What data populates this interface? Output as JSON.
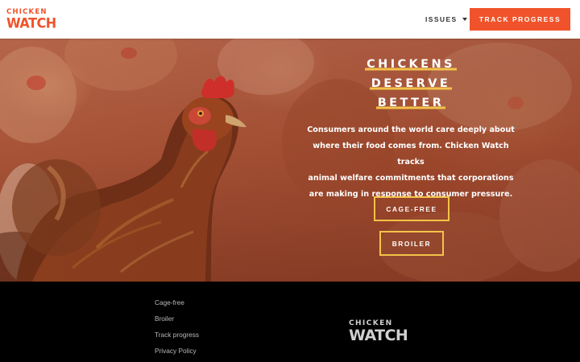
{
  "header": {
    "logo_top": "CHICKEN",
    "logo_bottom": "WATCH",
    "nav_issues": "ISSUES",
    "track_button": "TRACK PROGRESS"
  },
  "hero": {
    "image": "hen-photo",
    "title_lines": [
      "CHICKENS",
      "DESERVE",
      "BETTER"
    ],
    "body_lines": [
      "Consumers around the world care deeply about",
      "where their food comes from. Chicken Watch tracks",
      "animal welfare commitments that corporations",
      "are making in response to consumer pressure."
    ],
    "buttons": {
      "cage_free": "CAGE-FREE",
      "broiler": "BROILER"
    }
  },
  "footer": {
    "links": [
      "Cage-free",
      "Broiler",
      "Track progress",
      "Privacy Policy"
    ],
    "logo_top": "CHICKEN",
    "logo_bottom": "WATCH"
  },
  "colors": {
    "brand_orange": "#f0532b",
    "accent_yellow": "#f3c34a",
    "footer_bg": "#000000"
  }
}
